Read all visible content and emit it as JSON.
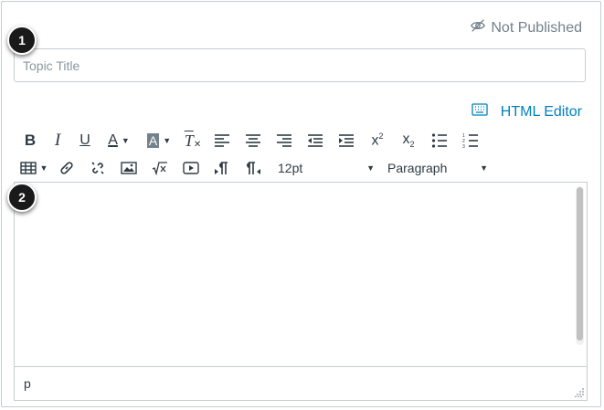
{
  "status": {
    "label": "Not Published"
  },
  "badges": [
    "1",
    "2"
  ],
  "topic_title": {
    "placeholder": "Topic Title",
    "value": ""
  },
  "html_editor": {
    "label": "HTML Editor"
  },
  "toolbar": {
    "bold": "B",
    "italic": "I",
    "underline": "U",
    "text_color": "A",
    "background_color": "A",
    "clear_formatting": "T",
    "superscript": "x",
    "subscript": "x",
    "font_size": "12pt",
    "format": "Paragraph"
  },
  "editor": {
    "path": "p"
  },
  "colors": {
    "accent": "#0081bd",
    "text": "#2d3b45",
    "muted": "#73818c",
    "border": "#c7cdd1"
  }
}
